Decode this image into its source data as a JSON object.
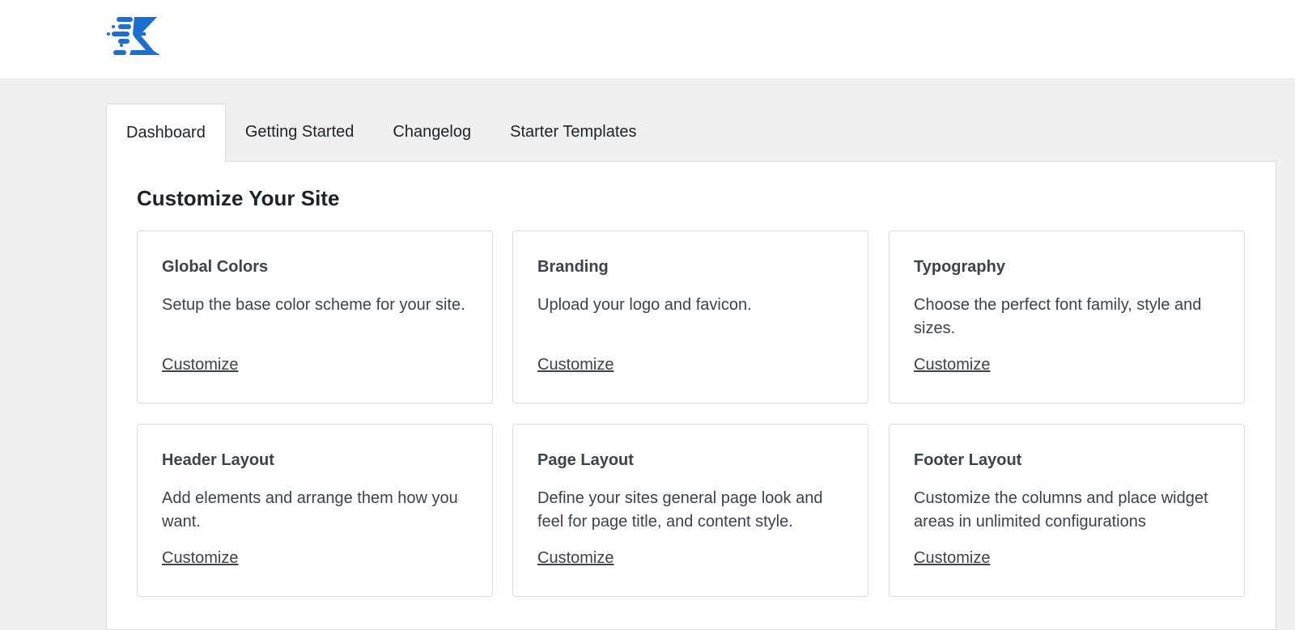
{
  "brand": {
    "logo_icon": "kadence-k-logo-icon",
    "accent_color": "#1b6fd1"
  },
  "tabs": [
    {
      "label": "Dashboard",
      "active": true
    },
    {
      "label": "Getting Started",
      "active": false
    },
    {
      "label": "Changelog",
      "active": false
    },
    {
      "label": "Starter Templates",
      "active": false
    }
  ],
  "main": {
    "title": "Customize Your Site",
    "cards": [
      {
        "title": "Global Colors",
        "description": "Setup the base color scheme for your site.",
        "link": "Customize"
      },
      {
        "title": "Branding",
        "description": "Upload your logo and favicon.",
        "link": "Customize"
      },
      {
        "title": "Typography",
        "description": "Choose the perfect font family, style and sizes.",
        "link": "Customize"
      },
      {
        "title": "Header Layout",
        "description": "Add elements and arrange them how you want.",
        "link": "Customize"
      },
      {
        "title": "Page Layout",
        "description": "Define your sites general page look and feel for page title, and content style.",
        "link": "Customize"
      },
      {
        "title": "Footer Layout",
        "description": "Customize the columns and place widget areas in unlimited configurations",
        "link": "Customize"
      }
    ]
  }
}
